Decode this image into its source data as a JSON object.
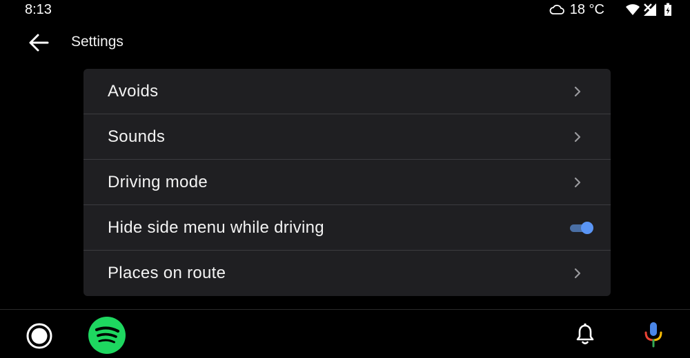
{
  "status_bar": {
    "time": "8:13",
    "temperature": "18 °C",
    "icons": [
      "cloud-icon",
      "wifi-icon",
      "no-signal-icon",
      "battery-charging-icon"
    ]
  },
  "header": {
    "title": "Settings",
    "back_icon": "arrow-back-icon"
  },
  "settings": {
    "items": [
      {
        "label": "Avoids",
        "control": "chevron"
      },
      {
        "label": "Sounds",
        "control": "chevron"
      },
      {
        "label": "Driving mode",
        "control": "chevron"
      },
      {
        "label": "Hide side menu while driving",
        "control": "toggle",
        "toggle_on": true
      },
      {
        "label": "Places on route",
        "control": "chevron"
      }
    ]
  },
  "bottom_bar": {
    "items": [
      "home-icon",
      "spotify-icon",
      "notification-bell-icon",
      "microphone-icon"
    ]
  },
  "colors": {
    "background": "#000000",
    "card": "#1f1f22",
    "divider": "#3c3c40",
    "accent_blue": "#5a95f5",
    "spotify_green": "#1ed760"
  }
}
